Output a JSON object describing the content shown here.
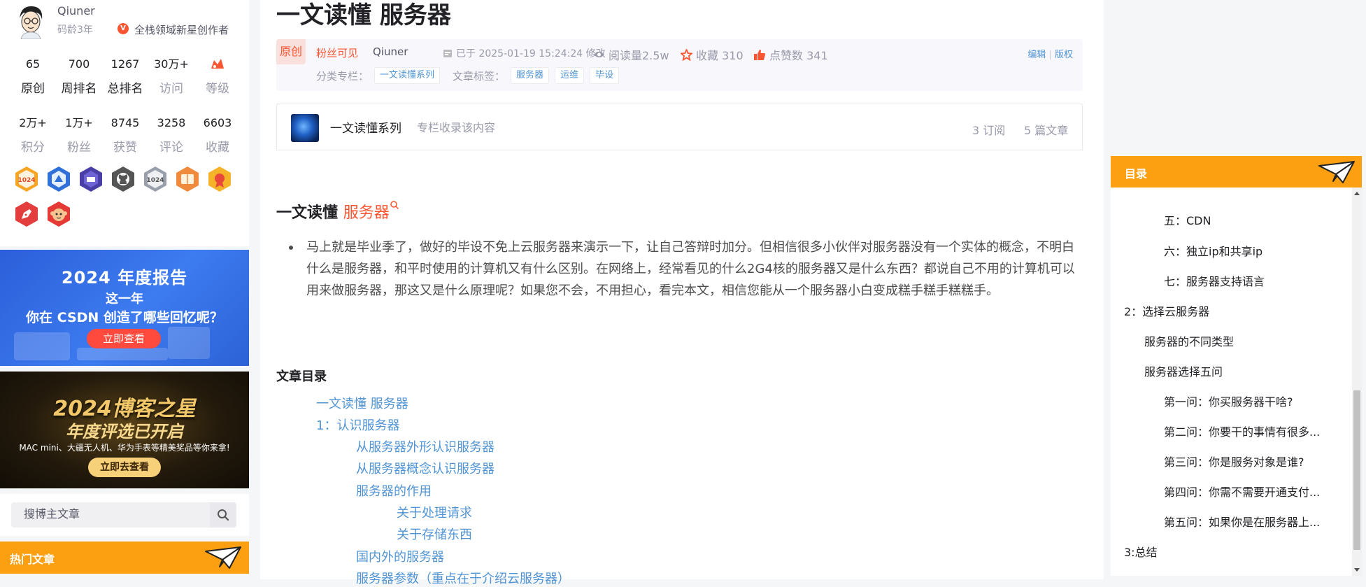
{
  "sidebar": {
    "username": "Qiuner",
    "code_age": "码龄3年",
    "creator_badge": "全栈领域新星创作者",
    "stats_row1": [
      {
        "num": "65",
        "label": "原创"
      },
      {
        "num": "700",
        "label": "周排名"
      },
      {
        "num": "1267",
        "label": "总排名"
      },
      {
        "num": "30万+",
        "label": "访问"
      },
      {
        "num": "",
        "label": "等级"
      }
    ],
    "stats_row2": [
      {
        "num": "2万+",
        "label": "积分"
      },
      {
        "num": "1万+",
        "label": "粉丝"
      },
      {
        "num": "8745",
        "label": "获赞"
      },
      {
        "num": "3258",
        "label": "评论"
      },
      {
        "num": "6603",
        "label": "收藏"
      }
    ],
    "badge_icons": [
      "badge-1024-icon",
      "badge-blue-icon",
      "badge-purple-icon",
      "badge-github-icon",
      "badge-1024-gray-icon",
      "badge-book-icon",
      "badge-medal-icon",
      "badge-pen-icon",
      "badge-monkey-icon"
    ],
    "ad1": {
      "line1": "2024 年度报告",
      "line2": "这一年",
      "line3": "你在 CSDN 创造了哪些回忆呢？",
      "button": "立即查看"
    },
    "ad2": {
      "line1": "2024博客之星",
      "line2": "年度评选已开启",
      "line3": "MAC mini、大疆无人机、华为手表等精美奖品等你来拿!",
      "button": "立即去查看"
    },
    "search_placeholder": "搜博主文章",
    "hot_title": "热门文章"
  },
  "article": {
    "title": "一文读懂 服务器",
    "original_tag": "原创",
    "fans_only": "粉丝可见",
    "author": "Qiuner",
    "modified": "已于 2025-01-19 15:24:24 修改",
    "reads": "阅读量2.5w",
    "favorites": "收藏 310",
    "likes": "点赞数 341",
    "edit": "编辑",
    "copyright": "版权",
    "category_label": "分类专栏：",
    "category": "一文读懂系列",
    "tags_label": "文章标签：",
    "tags": [
      "服务器",
      "运维",
      "毕设"
    ],
    "column": {
      "name": "一文读懂系列",
      "desc": "专栏收录该内容",
      "subs": "3 订阅",
      "count": "5 篇文章"
    },
    "heading_prefix": "一文读懂",
    "heading_highlight": "服务器",
    "intro": "马上就是毕业季了，做好的毕设不免上云服务器来演示一下，让自己答辩时加分。但相信很多小伙伴对服务器没有一个实体的概念，不明白什么是服务器，和平时使用的计算机又有什么区别。在网络上，经常看见的什么2G4核的服务器又是什么东西？都说自己不用的计算机可以用来做服务器，那这又是什么原理呢？如果您不会，不用担心，看完本文，相信您能从一个服务器小白变成糕手糕手糕糕手。",
    "toc_title": "文章目录",
    "toc": [
      "一文读懂 服务器",
      "1：认识服务器",
      "从服务器外形认识服务器",
      "从服务器概念认识服务器",
      "服务器的作用",
      "关于处理请求",
      "关于存储东西",
      "国内外的服务器",
      "服务器参数（重点在于介绍云服务器）"
    ]
  },
  "right_toc": {
    "title": "目录",
    "items": [
      "五：CDN",
      "六：独立ip和共享ip",
      "七：服务器支持语言",
      "2：选择云服务器",
      "服务器的不同类型",
      "服务器选择五问",
      "第一问：你买服务器干啥?",
      "第二问：你要干的事情有很多...",
      "第三问：你是服务对象是谁?",
      "第四问：你需不需要开通支付...",
      "第五问：如果你是在服务器上...",
      "3:总结"
    ]
  },
  "colors": {
    "accent": "#fc5531",
    "link": "#5094d5",
    "orange": "#fc9f10"
  }
}
